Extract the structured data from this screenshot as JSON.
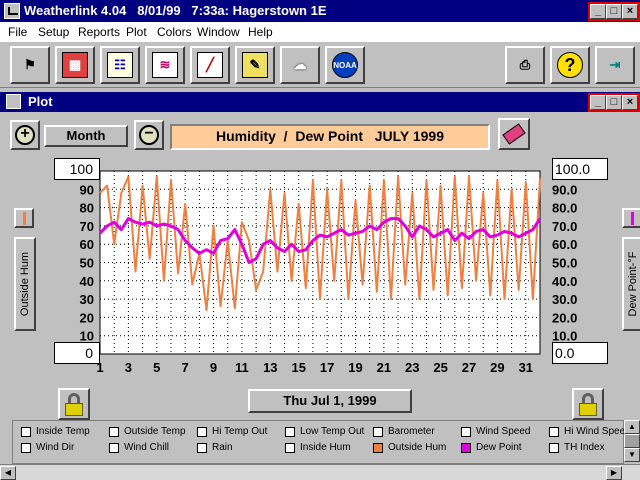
{
  "app": {
    "title": "Weatherlink 4.04   8/01/99   7:33a: Hagerstown 1E",
    "window_buttons": [
      "_",
      "□",
      "×"
    ]
  },
  "menu": [
    "File",
    "Setup",
    "Reports",
    "Plot",
    "Colors",
    "Window",
    "Help"
  ],
  "toolbar": {
    "icons": [
      "station-icon",
      "weather-data-icon",
      "bulletin-icon",
      "strip-chart-icon",
      "plot-icon",
      "notebook-icon",
      "rain-cloud-icon",
      "noaa-icon",
      "printer-icon",
      "help-icon",
      "exit-icon"
    ]
  },
  "plot_window": {
    "title": "Plot",
    "zoom_in": "+",
    "zoom_out": "−",
    "period_button": "Month",
    "plot_title": "Humidity  /  Dew Point   JULY 1999",
    "left_max": "100",
    "left_min": "0",
    "right_max": "100.0",
    "right_min": "0.0",
    "left_axis_label": "Outside Hum",
    "right_axis_label": "Dew Point-°F",
    "date_button": "Thu Jul 1, 1999"
  },
  "legend": {
    "items": [
      {
        "label": "Inside Temp",
        "checked": false
      },
      {
        "label": "Outside Temp",
        "checked": false
      },
      {
        "label": "Hi Temp Out",
        "checked": false
      },
      {
        "label": "Low Temp Out",
        "checked": false
      },
      {
        "label": "Barometer",
        "checked": false
      },
      {
        "label": "Wind Speed",
        "checked": false
      },
      {
        "label": "Hi Wind Speed",
        "checked": false
      },
      {
        "label": "Wind Dir",
        "checked": false
      },
      {
        "label": "Wind Chill",
        "checked": false
      },
      {
        "label": "Rain",
        "checked": false
      },
      {
        "label": "Inside Hum",
        "checked": false
      },
      {
        "label": "Outside Hum",
        "checked": true,
        "color": "#f08040"
      },
      {
        "label": "Dew Point",
        "checked": true,
        "color": "#e000e0"
      },
      {
        "label": "TH Index",
        "checked": false
      }
    ]
  },
  "chart_data": {
    "type": "line",
    "title": "Humidity  /  Dew Point   JULY 1999",
    "xlabel": "",
    "ylabel_left": "Outside Hum",
    "ylabel_right": "Dew Point-°F",
    "x_ticks": [
      "1",
      "3",
      "5",
      "7",
      "9",
      "11",
      "13",
      "15",
      "17",
      "19",
      "21",
      "23",
      "25",
      "27",
      "29",
      "31"
    ],
    "x_minor_ticks": [
      "2",
      "4",
      "6",
      "8",
      "10",
      "12",
      "14",
      "16",
      "18",
      "20",
      "22",
      "24",
      "26",
      "28",
      "30",
      "32"
    ],
    "y_ticks_left": [
      "100",
      "90",
      "80",
      "70",
      "60",
      "50",
      "40",
      "30",
      "20",
      "10",
      "0"
    ],
    "y_ticks_right": [
      "100.0",
      "90.0",
      "80.0",
      "70.0",
      "60.0",
      "50.0",
      "40.0",
      "30.0",
      "20.0",
      "10.0",
      "0.0"
    ],
    "xlim": [
      1,
      32
    ],
    "ylim": [
      0,
      100
    ],
    "grid": true,
    "series": [
      {
        "name": "Outside Hum",
        "color": "#f08040",
        "x": [
          1,
          1.5,
          2,
          2.5,
          3,
          3.5,
          4,
          4.5,
          5,
          5.5,
          6,
          6.5,
          7,
          7.5,
          8,
          8.5,
          9,
          9.5,
          10,
          10.5,
          11,
          11.5,
          12,
          12.5,
          13,
          13.5,
          14,
          14.5,
          15,
          15.5,
          16,
          16.5,
          17,
          17.5,
          18,
          18.5,
          19,
          19.5,
          20,
          20.5,
          21,
          21.5,
          22,
          22.5,
          23,
          23.5,
          24,
          24.5,
          25,
          25.5,
          26,
          26.5,
          27,
          27.5,
          28,
          28.5,
          29,
          29.5,
          30,
          30.5,
          31,
          31.5,
          32
        ],
        "values": [
          88,
          92,
          60,
          88,
          97,
          45,
          92,
          52,
          97,
          40,
          95,
          44,
          82,
          38,
          55,
          24,
          70,
          26,
          62,
          25,
          72,
          62,
          35,
          45,
          90,
          45,
          88,
          40,
          82,
          36,
          95,
          30,
          90,
          40,
          95,
          30,
          84,
          38,
          92,
          34,
          95,
          30,
          97,
          38,
          88,
          30,
          95,
          35,
          92,
          32,
          97,
          36,
          97,
          40,
          88,
          32,
          95,
          30,
          90,
          35,
          94,
          30,
          96
        ]
      },
      {
        "name": "Dew Point",
        "color": "#e000e0",
        "x": [
          1,
          1.5,
          2,
          2.5,
          3,
          3.5,
          4,
          4.5,
          5,
          5.5,
          6,
          6.5,
          7,
          7.5,
          8,
          8.5,
          9,
          9.5,
          10,
          10.5,
          11,
          11.5,
          12,
          12.5,
          13,
          13.5,
          14,
          14.5,
          15,
          15.5,
          16,
          16.5,
          17,
          17.5,
          18,
          18.5,
          19,
          19.5,
          20,
          20.5,
          21,
          21.5,
          22,
          22.5,
          23,
          23.5,
          24,
          24.5,
          25,
          25.5,
          26,
          26.5,
          27,
          27.5,
          28,
          28.5,
          29,
          29.5,
          30,
          30.5,
          31,
          31.5,
          32
        ],
        "values": [
          66,
          70,
          72,
          68,
          74,
          72,
          71,
          72,
          70,
          71,
          70,
          68,
          62,
          58,
          55,
          57,
          55,
          62,
          63,
          68,
          60,
          50,
          52,
          60,
          62,
          58,
          56,
          60,
          56,
          57,
          62,
          65,
          64,
          66,
          68,
          65,
          66,
          67,
          70,
          68,
          72,
          74,
          74,
          70,
          64,
          70,
          68,
          64,
          66,
          68,
          62,
          66,
          63,
          67,
          68,
          64,
          65,
          67,
          66,
          64,
          66,
          68,
          74
        ]
      }
    ]
  }
}
